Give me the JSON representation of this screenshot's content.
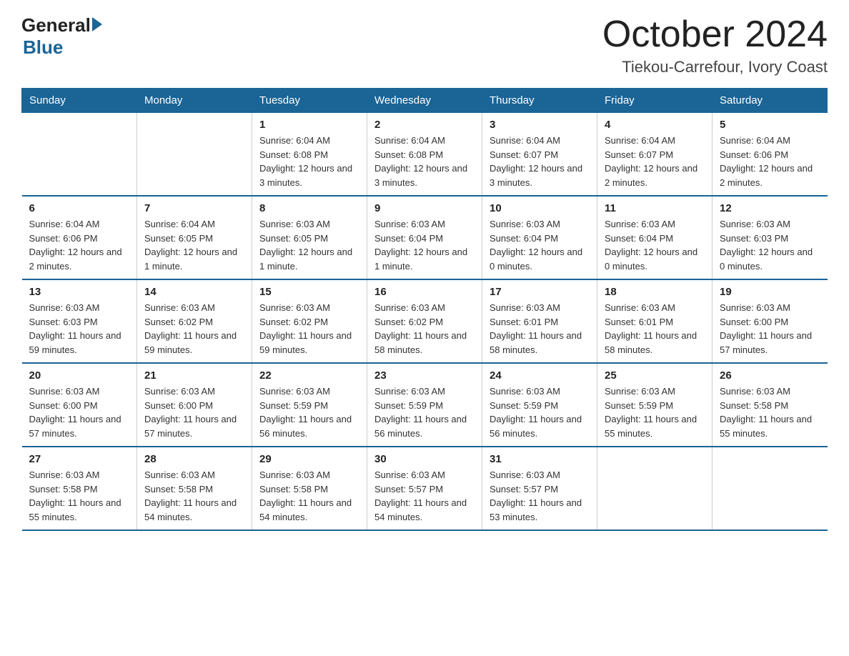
{
  "logo": {
    "text_general": "General",
    "text_blue": "Blue"
  },
  "header": {
    "title": "October 2024",
    "subtitle": "Tiekou-Carrefour, Ivory Coast"
  },
  "columns": [
    "Sunday",
    "Monday",
    "Tuesday",
    "Wednesday",
    "Thursday",
    "Friday",
    "Saturday"
  ],
  "weeks": [
    [
      {
        "day": "",
        "sunrise": "",
        "sunset": "",
        "daylight": ""
      },
      {
        "day": "",
        "sunrise": "",
        "sunset": "",
        "daylight": ""
      },
      {
        "day": "1",
        "sunrise": "Sunrise: 6:04 AM",
        "sunset": "Sunset: 6:08 PM",
        "daylight": "Daylight: 12 hours and 3 minutes."
      },
      {
        "day": "2",
        "sunrise": "Sunrise: 6:04 AM",
        "sunset": "Sunset: 6:08 PM",
        "daylight": "Daylight: 12 hours and 3 minutes."
      },
      {
        "day": "3",
        "sunrise": "Sunrise: 6:04 AM",
        "sunset": "Sunset: 6:07 PM",
        "daylight": "Daylight: 12 hours and 3 minutes."
      },
      {
        "day": "4",
        "sunrise": "Sunrise: 6:04 AM",
        "sunset": "Sunset: 6:07 PM",
        "daylight": "Daylight: 12 hours and 2 minutes."
      },
      {
        "day": "5",
        "sunrise": "Sunrise: 6:04 AM",
        "sunset": "Sunset: 6:06 PM",
        "daylight": "Daylight: 12 hours and 2 minutes."
      }
    ],
    [
      {
        "day": "6",
        "sunrise": "Sunrise: 6:04 AM",
        "sunset": "Sunset: 6:06 PM",
        "daylight": "Daylight: 12 hours and 2 minutes."
      },
      {
        "day": "7",
        "sunrise": "Sunrise: 6:04 AM",
        "sunset": "Sunset: 6:05 PM",
        "daylight": "Daylight: 12 hours and 1 minute."
      },
      {
        "day": "8",
        "sunrise": "Sunrise: 6:03 AM",
        "sunset": "Sunset: 6:05 PM",
        "daylight": "Daylight: 12 hours and 1 minute."
      },
      {
        "day": "9",
        "sunrise": "Sunrise: 6:03 AM",
        "sunset": "Sunset: 6:04 PM",
        "daylight": "Daylight: 12 hours and 1 minute."
      },
      {
        "day": "10",
        "sunrise": "Sunrise: 6:03 AM",
        "sunset": "Sunset: 6:04 PM",
        "daylight": "Daylight: 12 hours and 0 minutes."
      },
      {
        "day": "11",
        "sunrise": "Sunrise: 6:03 AM",
        "sunset": "Sunset: 6:04 PM",
        "daylight": "Daylight: 12 hours and 0 minutes."
      },
      {
        "day": "12",
        "sunrise": "Sunrise: 6:03 AM",
        "sunset": "Sunset: 6:03 PM",
        "daylight": "Daylight: 12 hours and 0 minutes."
      }
    ],
    [
      {
        "day": "13",
        "sunrise": "Sunrise: 6:03 AM",
        "sunset": "Sunset: 6:03 PM",
        "daylight": "Daylight: 11 hours and 59 minutes."
      },
      {
        "day": "14",
        "sunrise": "Sunrise: 6:03 AM",
        "sunset": "Sunset: 6:02 PM",
        "daylight": "Daylight: 11 hours and 59 minutes."
      },
      {
        "day": "15",
        "sunrise": "Sunrise: 6:03 AM",
        "sunset": "Sunset: 6:02 PM",
        "daylight": "Daylight: 11 hours and 59 minutes."
      },
      {
        "day": "16",
        "sunrise": "Sunrise: 6:03 AM",
        "sunset": "Sunset: 6:02 PM",
        "daylight": "Daylight: 11 hours and 58 minutes."
      },
      {
        "day": "17",
        "sunrise": "Sunrise: 6:03 AM",
        "sunset": "Sunset: 6:01 PM",
        "daylight": "Daylight: 11 hours and 58 minutes."
      },
      {
        "day": "18",
        "sunrise": "Sunrise: 6:03 AM",
        "sunset": "Sunset: 6:01 PM",
        "daylight": "Daylight: 11 hours and 58 minutes."
      },
      {
        "day": "19",
        "sunrise": "Sunrise: 6:03 AM",
        "sunset": "Sunset: 6:00 PM",
        "daylight": "Daylight: 11 hours and 57 minutes."
      }
    ],
    [
      {
        "day": "20",
        "sunrise": "Sunrise: 6:03 AM",
        "sunset": "Sunset: 6:00 PM",
        "daylight": "Daylight: 11 hours and 57 minutes."
      },
      {
        "day": "21",
        "sunrise": "Sunrise: 6:03 AM",
        "sunset": "Sunset: 6:00 PM",
        "daylight": "Daylight: 11 hours and 57 minutes."
      },
      {
        "day": "22",
        "sunrise": "Sunrise: 6:03 AM",
        "sunset": "Sunset: 5:59 PM",
        "daylight": "Daylight: 11 hours and 56 minutes."
      },
      {
        "day": "23",
        "sunrise": "Sunrise: 6:03 AM",
        "sunset": "Sunset: 5:59 PM",
        "daylight": "Daylight: 11 hours and 56 minutes."
      },
      {
        "day": "24",
        "sunrise": "Sunrise: 6:03 AM",
        "sunset": "Sunset: 5:59 PM",
        "daylight": "Daylight: 11 hours and 56 minutes."
      },
      {
        "day": "25",
        "sunrise": "Sunrise: 6:03 AM",
        "sunset": "Sunset: 5:59 PM",
        "daylight": "Daylight: 11 hours and 55 minutes."
      },
      {
        "day": "26",
        "sunrise": "Sunrise: 6:03 AM",
        "sunset": "Sunset: 5:58 PM",
        "daylight": "Daylight: 11 hours and 55 minutes."
      }
    ],
    [
      {
        "day": "27",
        "sunrise": "Sunrise: 6:03 AM",
        "sunset": "Sunset: 5:58 PM",
        "daylight": "Daylight: 11 hours and 55 minutes."
      },
      {
        "day": "28",
        "sunrise": "Sunrise: 6:03 AM",
        "sunset": "Sunset: 5:58 PM",
        "daylight": "Daylight: 11 hours and 54 minutes."
      },
      {
        "day": "29",
        "sunrise": "Sunrise: 6:03 AM",
        "sunset": "Sunset: 5:58 PM",
        "daylight": "Daylight: 11 hours and 54 minutes."
      },
      {
        "day": "30",
        "sunrise": "Sunrise: 6:03 AM",
        "sunset": "Sunset: 5:57 PM",
        "daylight": "Daylight: 11 hours and 54 minutes."
      },
      {
        "day": "31",
        "sunrise": "Sunrise: 6:03 AM",
        "sunset": "Sunset: 5:57 PM",
        "daylight": "Daylight: 11 hours and 53 minutes."
      },
      {
        "day": "",
        "sunrise": "",
        "sunset": "",
        "daylight": ""
      },
      {
        "day": "",
        "sunrise": "",
        "sunset": "",
        "daylight": ""
      }
    ]
  ]
}
